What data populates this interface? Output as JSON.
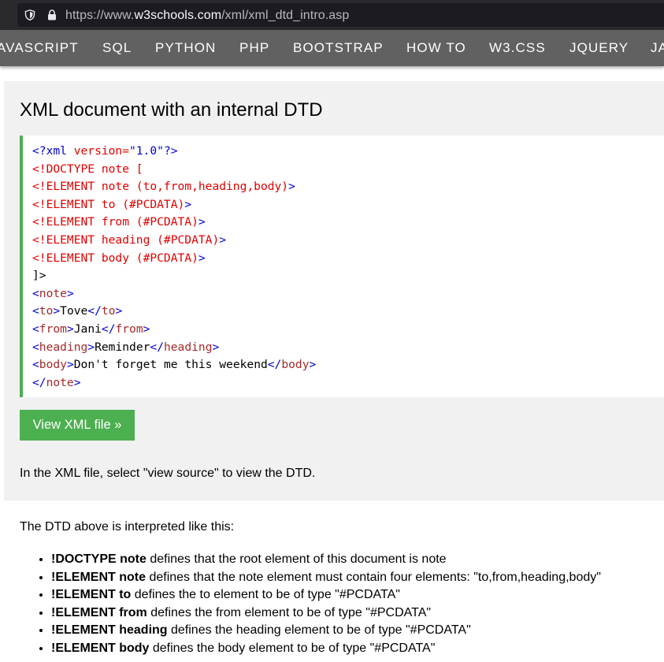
{
  "browser": {
    "url_prefix": "https://www.",
    "url_host": "w3schools.com",
    "url_path": "/xml/xml_dtd_intro.asp"
  },
  "nav": {
    "items": [
      "AVASCRIPT",
      "SQL",
      "PYTHON",
      "PHP",
      "BOOTSTRAP",
      "HOW TO",
      "W3.CSS",
      "JQUERY",
      "JA"
    ]
  },
  "example": {
    "title": "XML document with an internal DTD",
    "code": {
      "l1": {
        "a": "<?xml ",
        "b": "version=",
        "c": "\"1.0\"",
        "d": "?>"
      },
      "l2": "<!DOCTYPE note [",
      "l3": {
        "a": "<!ELEMENT note (to,from,heading,body)",
        "b": ">"
      },
      "l4": {
        "a": "<!ELEMENT to (#PCDATA)",
        "b": ">"
      },
      "l5": {
        "a": "<!ELEMENT from (#PCDATA)",
        "b": ">"
      },
      "l6": {
        "a": "<!ELEMENT heading (#PCDATA)",
        "b": ">"
      },
      "l7": {
        "a": "<!ELEMENT body (#PCDATA)",
        "b": ">"
      },
      "l8": "]>",
      "l9": {
        "a": "<",
        "b": "note",
        "c": ">"
      },
      "l10": {
        "a": "<",
        "b": "to",
        "c": ">",
        "d": "Tove",
        "e": "</",
        "f": "to",
        "g": ">"
      },
      "l11": {
        "a": "<",
        "b": "from",
        "c": ">",
        "d": "Jani",
        "e": "</",
        "f": "from",
        "g": ">"
      },
      "l12": {
        "a": "<",
        "b": "heading",
        "c": ">",
        "d": "Reminder",
        "e": "</",
        "f": "heading",
        "g": ">"
      },
      "l13": {
        "a": "<",
        "b": "body",
        "c": ">",
        "d": "Don't forget me this weekend",
        "e": "</",
        "f": "body",
        "g": ">"
      },
      "l14": {
        "a": "</",
        "b": "note",
        "c": ">"
      }
    },
    "button_label": "View XML file »",
    "note": "In the XML file, select \"view source\" to view the DTD."
  },
  "explanation": {
    "intro": "The DTD above is interpreted like this:",
    "items": [
      {
        "term": "!DOCTYPE note",
        "desc": " defines that the root element of this document is note"
      },
      {
        "term": "!ELEMENT note",
        "desc": " defines that the note element must contain four elements: \"to,from,heading,body\""
      },
      {
        "term": "!ELEMENT to",
        "desc": " defines the to element to be of type \"#PCDATA\""
      },
      {
        "term": "!ELEMENT from",
        "desc": " defines the from element to be of type \"#PCDATA\""
      },
      {
        "term": "!ELEMENT heading",
        "desc": " defines the heading element to be of type \"#PCDATA\""
      },
      {
        "term": "!ELEMENT body",
        "desc": " defines the body element to be of type \"#PCDATA\""
      }
    ]
  },
  "colors": {
    "nav_bg": "#616161",
    "panel_bg": "#f1f1f1",
    "accent_green": "#4caf50",
    "code_tag_blue": "#0000cd",
    "code_decl_red": "#e00000",
    "code_tagname_brown": "#a52a2a"
  }
}
